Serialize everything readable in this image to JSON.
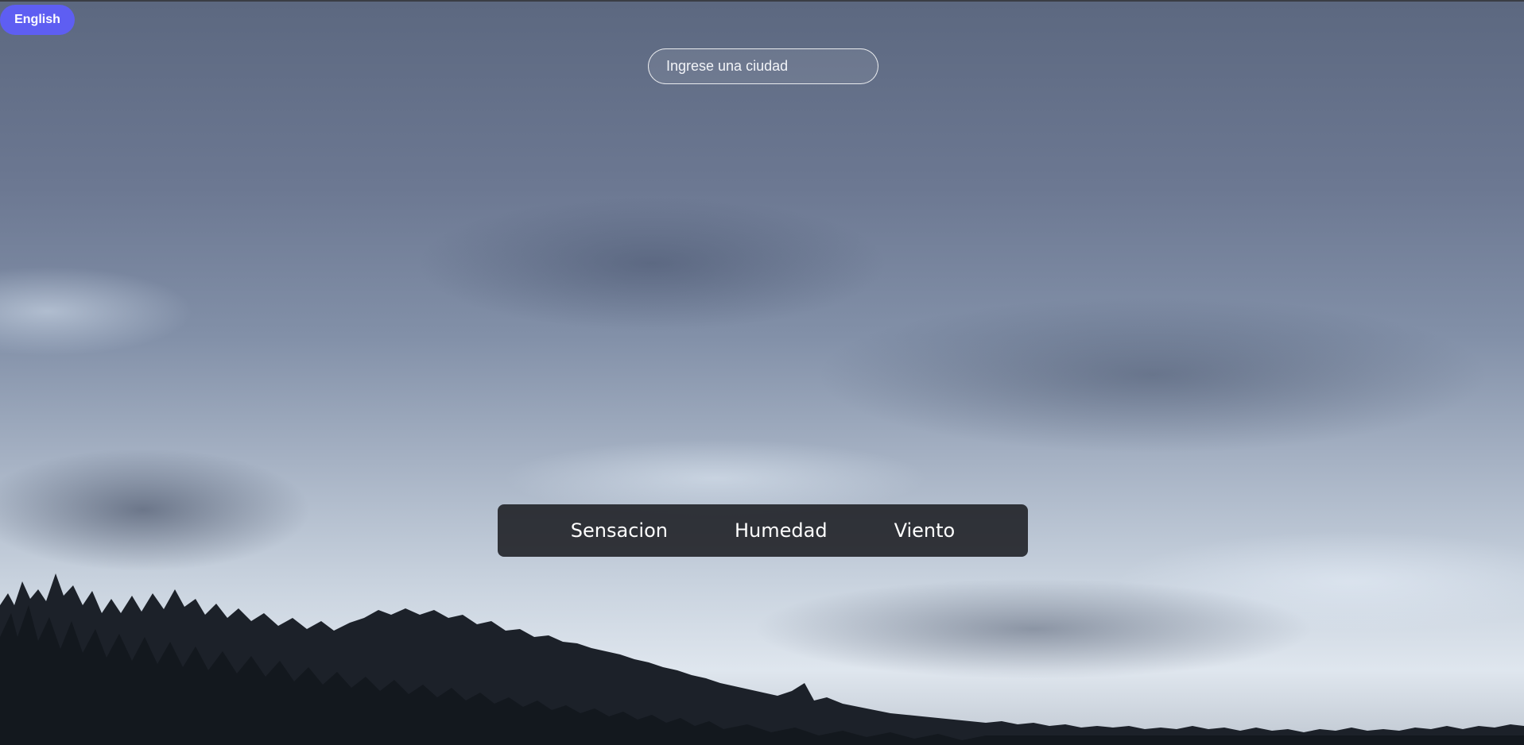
{
  "header": {
    "language_button": "English"
  },
  "search": {
    "placeholder": "Ingrese una ciudad",
    "value": ""
  },
  "details": {
    "items": [
      {
        "label": "Sensacion"
      },
      {
        "label": "Humedad"
      },
      {
        "label": "Viento"
      }
    ]
  },
  "colors": {
    "accent": "#5e5ef2",
    "panel": "#18191e",
    "text": "#ffffff"
  }
}
